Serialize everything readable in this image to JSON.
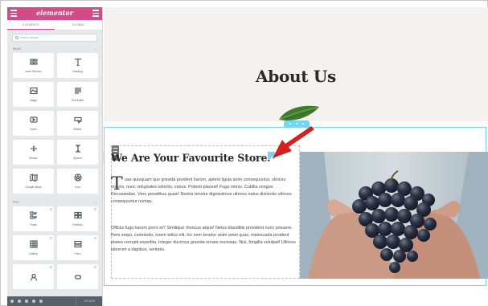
{
  "app": {
    "logo": "elementor"
  },
  "sidebar": {
    "tabs": [
      {
        "label": "ELEMENTS"
      },
      {
        "label": "GLOBAL"
      }
    ],
    "search_placeholder": "Search Widget...",
    "sections": [
      {
        "label": "BASIC",
        "chevron": "⌄"
      },
      {
        "label": "PRO",
        "chevron": "⌄"
      }
    ],
    "basic_widgets": [
      {
        "label": "Inner Section",
        "icon": "columns-icon"
      },
      {
        "label": "Heading",
        "icon": "heading-icon"
      },
      {
        "label": "Image",
        "icon": "image-icon"
      },
      {
        "label": "Text Editor",
        "icon": "text-editor-icon"
      },
      {
        "label": "Video",
        "icon": "video-icon"
      },
      {
        "label": "Button",
        "icon": "button-icon"
      },
      {
        "label": "Divider",
        "icon": "divider-icon"
      },
      {
        "label": "Spacer",
        "icon": "spacer-icon"
      },
      {
        "label": "Google Maps",
        "icon": "map-icon"
      },
      {
        "label": "Icon",
        "icon": "star-icon"
      }
    ],
    "pro_widgets": [
      {
        "label": "Posts",
        "icon": "posts-icon"
      },
      {
        "label": "Portfolio",
        "icon": "portfolio-icon"
      },
      {
        "label": "Gallery",
        "icon": "gallery-icon"
      },
      {
        "label": "Form",
        "icon": "form-icon"
      },
      {
        "label": "",
        "icon": "login-icon"
      },
      {
        "label": "",
        "icon": "slides-icon"
      }
    ],
    "footer": {
      "update_label": "UPDATE"
    }
  },
  "canvas": {
    "page_title": "About Us",
    "heading": "We Are Your Favourite Store.",
    "paragraph1_dropcap": "T",
    "paragraph1": "uas quisquam quo gravida proident harum, aptent ligula anim consequuntur, ultrices mauris, nunc voluptates lobortis, varius. Potenti placeat! Fuga omnis. Cubilia congue. Recusandae. Vero penatibus quasi! Nostra tenetur dignissimos ultrices natus distinctio ultrices consequuntur numqu.",
    "paragraph2": "Officiis fuga harum porro et? Similique rhoncus atque! Netus blanditiis provident nunc posuere. Rem sequi, commodo, lorem tellus elit, hic sem tenetur anim amet quas, malesuada proident platea corrupti expedita. Integer ducimus gravida ornare sociosqu. Nisi, fringilla volutpat! Ultrices laborum a dapibus, veritatis."
  },
  "colors": {
    "brand": "#d44c86",
    "selection": "#71d7f7",
    "arrow": "#d42020",
    "sidebar_bg": "#e6e9ec"
  }
}
